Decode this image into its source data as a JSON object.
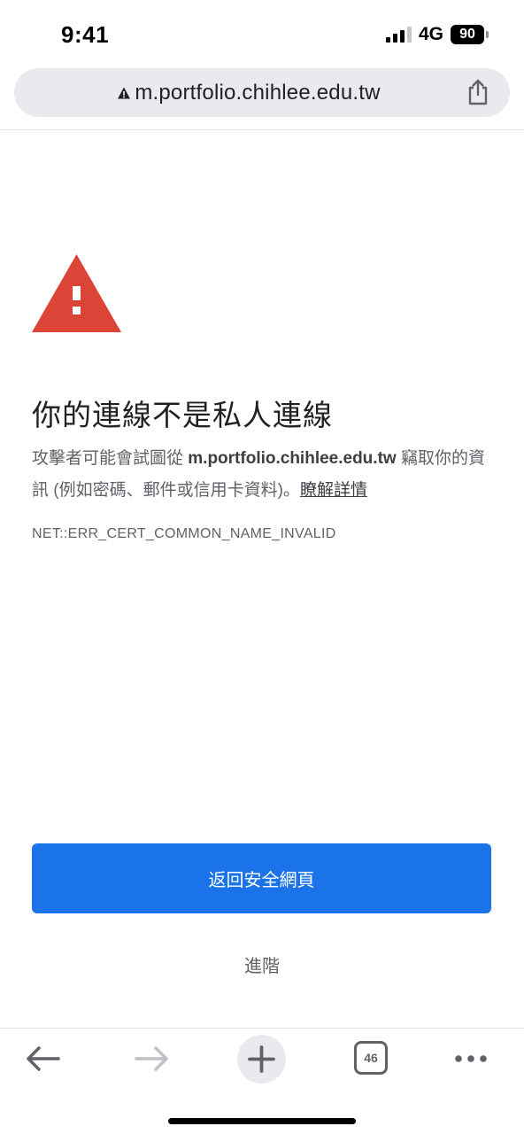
{
  "status_bar": {
    "time": "9:41",
    "network": "4G",
    "battery": "90"
  },
  "address_bar": {
    "url": "m.portfolio.chihlee.edu.tw",
    "security_icon": "warning-triangle-icon",
    "share_icon": "share-icon"
  },
  "interstitial": {
    "alert_icon": "red-warning-triangle-icon",
    "title": "你的連線不是私人連線",
    "desc_before": "攻擊者可能會試圖從 ",
    "desc_host": "m.portfolio.chihlee.edu.tw",
    "desc_after": " 竊取你的資訊 (例如密碼、郵件或信用卡資料)。",
    "learn_more": "瞭解詳情",
    "error_code": "NET::ERR_CERT_COMMON_NAME_INVALID",
    "primary_button": "返回安全網頁",
    "secondary_button": "進階"
  },
  "toolbar": {
    "back_icon": "back-arrow-icon",
    "forward_icon": "forward-arrow-icon",
    "new_tab_icon": "plus-icon",
    "tab_count": "46",
    "menu_icon": "more-dots-icon"
  },
  "colors": {
    "accent": "#1a73e8",
    "alert_red": "#db4437",
    "text_primary": "#202124",
    "text_secondary": "#5f6368",
    "url_bar_bg": "#e8eaed"
  }
}
